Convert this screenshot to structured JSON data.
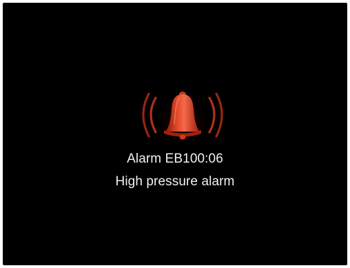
{
  "alarm": {
    "icon": "alarm-bell-icon",
    "code_label": "Alarm EB100:06",
    "description": "High pressure alarm"
  },
  "colors": {
    "background": "#000000",
    "bell_light": "#f36a4a",
    "bell_mid": "#d8361c",
    "bell_dark": "#8e1608",
    "wave": "#c9341e",
    "text": "#f2f2f2"
  }
}
